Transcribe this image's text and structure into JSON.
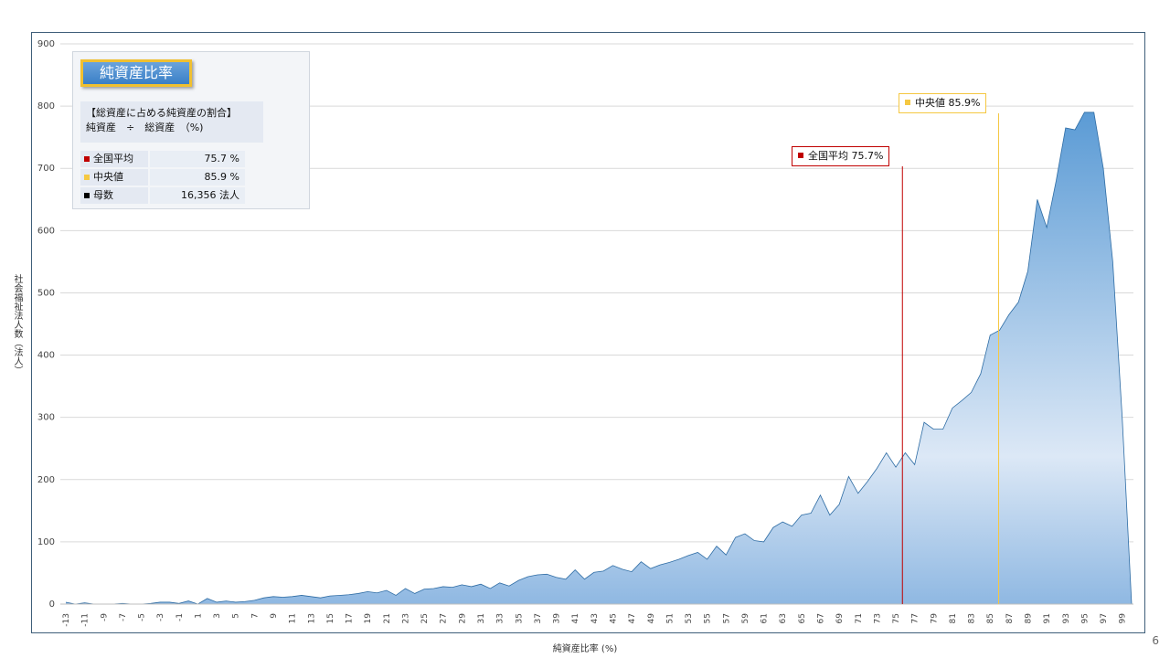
{
  "colors": {
    "area_top": "#5b9bd5",
    "area_bottom": "#dce8f6",
    "line": "#2e6ca4",
    "average": "#c00000",
    "median": "#f5c842",
    "count": "#000000"
  },
  "info_box": {
    "title": "純資産比率",
    "desc_line1": "【総資産に占める純資産の割合】",
    "desc_line2": "純資産　÷　総資産　（%)",
    "rows": [
      {
        "label": "全国平均",
        "value": "75.7  %"
      },
      {
        "label": "中央値",
        "value": "85.9  %"
      },
      {
        "label": "母数",
        "value": "16,356  法人"
      }
    ]
  },
  "callouts": {
    "average": "全国平均  75.7%",
    "median": "中央値  85.9%"
  },
  "page_number": "6",
  "chart_data": {
    "type": "area",
    "xlabel": "純資産比率 (%)",
    "ylabel": "社会福祉法人数（法人）",
    "ylim": [
      0,
      900
    ],
    "yticks": [
      0,
      100,
      200,
      300,
      400,
      500,
      600,
      700,
      800,
      900
    ],
    "grid": true,
    "x": [
      -13,
      -12,
      -11,
      -10,
      -9,
      -8,
      -7,
      -6,
      -5,
      -4,
      -3,
      -2,
      -1,
      0,
      1,
      2,
      3,
      4,
      5,
      6,
      7,
      8,
      9,
      10,
      11,
      12,
      13,
      14,
      15,
      16,
      17,
      18,
      19,
      20,
      21,
      22,
      23,
      24,
      25,
      26,
      27,
      28,
      29,
      30,
      31,
      32,
      33,
      34,
      35,
      36,
      37,
      38,
      39,
      40,
      41,
      42,
      43,
      44,
      45,
      46,
      47,
      48,
      49,
      50,
      51,
      52,
      53,
      54,
      55,
      56,
      57,
      58,
      59,
      60,
      61,
      62,
      63,
      64,
      65,
      66,
      67,
      68,
      69,
      70,
      71,
      72,
      73,
      74,
      75,
      76,
      77,
      78,
      79,
      80,
      81,
      82,
      83,
      84,
      85,
      86,
      87,
      88,
      89,
      90,
      91,
      92,
      93,
      94,
      95,
      96,
      97,
      98,
      99,
      100
    ],
    "xtick_labels": [
      "-13",
      "-11",
      "-9",
      "-7",
      "-5",
      "-3",
      "-1",
      "1",
      "3",
      "5",
      "7",
      "9",
      "11",
      "13",
      "15",
      "17",
      "19",
      "21",
      "23",
      "25",
      "27",
      "29",
      "31",
      "33",
      "35",
      "37",
      "39",
      "41",
      "43",
      "45",
      "47",
      "49",
      "51",
      "53",
      "55",
      "57",
      "59",
      "61",
      "63",
      "65",
      "67",
      "69",
      "71",
      "73",
      "75",
      "77",
      "79",
      "81",
      "83",
      "85",
      "87",
      "89",
      "91",
      "93",
      "95",
      "97",
      "99"
    ],
    "values": [
      3,
      0,
      2,
      0,
      0,
      0,
      1,
      0,
      0,
      1,
      3,
      3,
      1,
      5,
      0,
      9,
      3,
      5,
      3,
      4,
      6,
      10,
      12,
      11,
      12,
      14,
      12,
      10,
      13,
      14,
      15,
      17,
      20,
      18,
      22,
      14,
      25,
      17,
      24,
      25,
      28,
      27,
      31,
      28,
      32,
      25,
      34,
      29,
      38,
      44,
      47,
      48,
      43,
      40,
      55,
      40,
      51,
      53,
      62,
      56,
      52,
      68,
      57,
      63,
      67,
      72,
      78,
      83,
      72,
      93,
      79,
      107,
      113,
      102,
      100,
      123,
      132,
      125,
      143,
      146,
      175,
      143,
      160,
      205,
      178,
      197,
      218,
      243,
      220,
      243,
      224,
      292,
      281,
      281,
      315,
      327,
      340,
      370,
      432,
      440,
      465,
      485,
      535,
      650,
      605,
      680,
      765,
      762,
      790,
      790,
      700,
      550,
      300,
      0
    ],
    "average": 75.7,
    "median": 85.9
  }
}
